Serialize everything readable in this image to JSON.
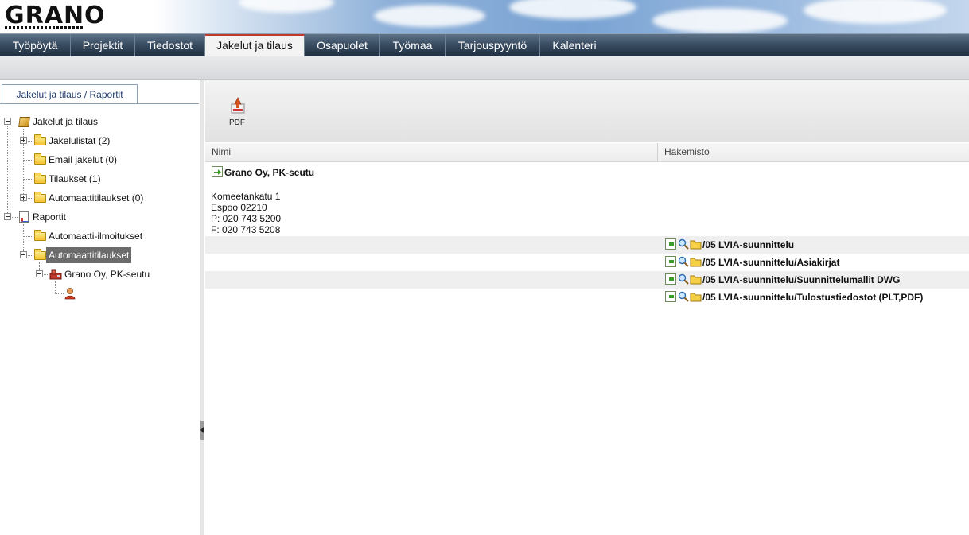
{
  "brand": {
    "logo_text": "GRANO"
  },
  "nav": {
    "tabs": [
      {
        "label": "Työpöytä"
      },
      {
        "label": "Projektit"
      },
      {
        "label": "Tiedostot"
      },
      {
        "label": "Jakelut ja tilaus",
        "active": true
      },
      {
        "label": "Osapuolet"
      },
      {
        "label": "Työmaa"
      },
      {
        "label": "Tarjouspyyntö"
      },
      {
        "label": "Kalenteri"
      }
    ]
  },
  "left_panel": {
    "breadcrumb": "Jakelut ja tilaus / Raportit",
    "tree": {
      "root1": "Jakelut ja tilaus",
      "jakelulistat": "Jakelulistat (2)",
      "email": "Email jakelut (0)",
      "tilaukset": "Tilaukset (1)",
      "auto_tilaukset": "Automaattitilaukset (0)",
      "root2": "Raportit",
      "auto_ilmoitukset": "Automaatti-ilmoitukset",
      "auto_tilaukset_sel": "Automaattitilaukset",
      "company": "Grano Oy, PK-seutu"
    }
  },
  "toolbar": {
    "pdf_label": "PDF"
  },
  "grid": {
    "columns": {
      "name": "Nimi",
      "directory": "Hakemisto"
    },
    "company": {
      "name": "Grano Oy, PK-seutu",
      "street": "Komeetankatu 1",
      "city": "Espoo 02210",
      "phone": "P: 020 743 5200",
      "fax": "F: 020 743 5208"
    },
    "rows": [
      {
        "path": "/05 LVIA-suunnittelu"
      },
      {
        "path": "/05 LVIA-suunnittelu/Asiakirjat"
      },
      {
        "path": "/05 LVIA-suunnittelu/Suunnittelumallit DWG"
      },
      {
        "path": "/05 LVIA-suunnittelu/Tulostustiedostot (PLT,PDF)"
      }
    ]
  }
}
